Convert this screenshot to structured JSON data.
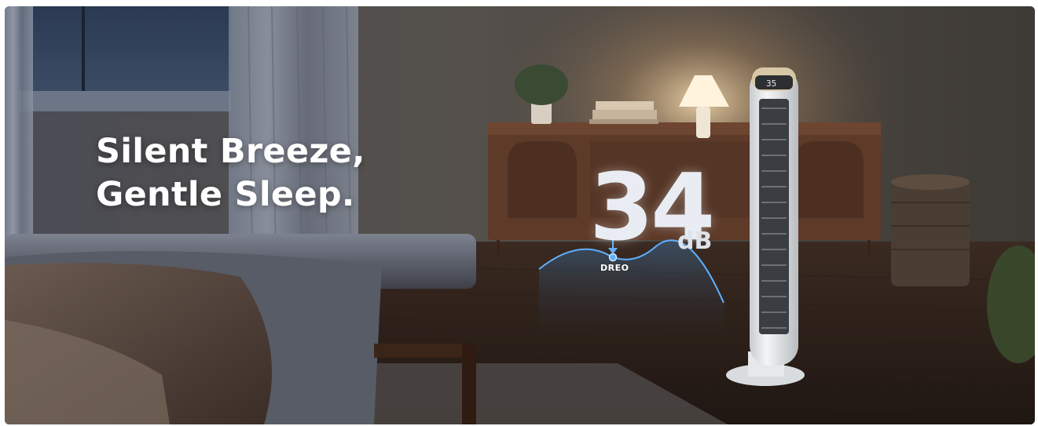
{
  "headline": {
    "line1": "Silent Breeze,",
    "line2": "Gentle Sleep."
  },
  "noise": {
    "value": "34",
    "unit": "dB"
  },
  "brand": "DREO",
  "fan_display": "35"
}
